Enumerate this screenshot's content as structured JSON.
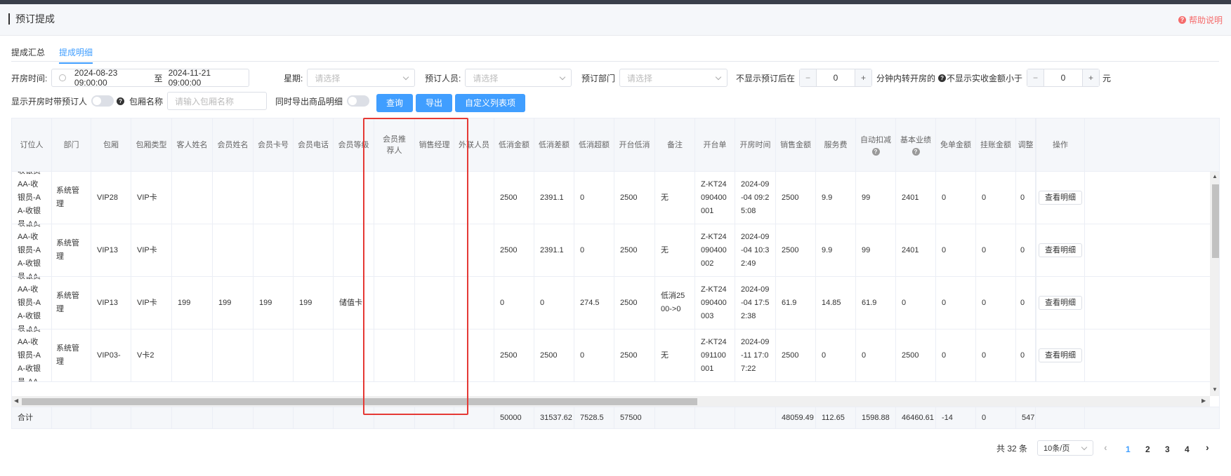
{
  "header": {
    "title": "预订提成",
    "help": "帮助说明"
  },
  "tabs": [
    {
      "label": "提成汇总",
      "active": false
    },
    {
      "label": "提成明细",
      "active": true
    }
  ],
  "filters": {
    "open_time_label": "开房时间:",
    "date_start": "2024-08-23 09:00:00",
    "date_sep": "至",
    "date_end": "2024-11-21 09:00:00",
    "weekday_label": "星期:",
    "weekday_placeholder": "请选择",
    "booker_label": "预订人员:",
    "booker_placeholder": "请选择",
    "dept_label": "预订部门",
    "dept_placeholder": "请选择",
    "hide_after_label": "不显示预订后在",
    "hide_after_value": "0",
    "minutes_label": "分钟内转开房的",
    "hide_amount_label": "不显示实收金额小于",
    "hide_amount_value": "0",
    "yuan": "元",
    "show_booker_label": "显示开房时带预订人",
    "room_name_label": "包厢名称",
    "room_name_placeholder": "请输入包厢名称",
    "export_goods_label": "同时导出商品明细",
    "query_btn": "查询",
    "export_btn": "导出",
    "custom_cols_btn": "自定义列表项",
    "minus": "−",
    "plus": "+"
  },
  "table": {
    "columns": [
      "订位人",
      "部门",
      "包厢",
      "包厢类型",
      "客人姓名",
      "会员姓名",
      "会员卡号",
      "会员电话",
      "会员等级",
      "会员推荐人",
      "销售经理",
      "外联人员",
      "低消金额",
      "低消差额",
      "低消超额",
      "开台低消",
      "备注",
      "开台单",
      "开房时间",
      "销售金额",
      "服务费",
      "自动扣减",
      "基本业绩",
      "免单金额",
      "挂账金额",
      "调整",
      "操作"
    ],
    "rows": [
      [
        "收银员-AA-收银员-AA-收银员-AA",
        "系统管理",
        "VIP28",
        "VIP卡",
        "",
        "",
        "",
        "",
        "",
        "",
        "",
        "",
        "2500",
        "2391.1",
        "0",
        "2500",
        "无",
        "Z-KT24090400001",
        "2024-09-04 09:25:08",
        "2500",
        "9.9",
        "99",
        "2401",
        "0",
        "0",
        "0",
        "查看明细"
      ],
      [
        "收银员-AA-收银员-AA-收银员-AA",
        "系统管理",
        "VIP13",
        "VIP卡",
        "",
        "",
        "",
        "",
        "",
        "",
        "",
        "",
        "2500",
        "2391.1",
        "0",
        "2500",
        "无",
        "Z-KT24090400002",
        "2024-09-04 10:32:49",
        "2500",
        "9.9",
        "99",
        "2401",
        "0",
        "0",
        "0",
        "查看明细"
      ],
      [
        "收银员-AA-收银员-AA-收银员-AA",
        "系统管理",
        "VIP13",
        "VIP卡",
        "199",
        "199",
        "199",
        "199",
        "储值卡",
        "",
        "",
        "",
        "0",
        "0",
        "274.5",
        "2500",
        "低消2500->0",
        "Z-KT24090400003",
        "2024-09-04 17:52:38",
        "61.9",
        "14.85",
        "61.9",
        "0",
        "0",
        "0",
        "0",
        "查看明细"
      ],
      [
        "收银员-AA-收银员-AA-收银员-AA",
        "系统管理",
        "VIP03-",
        "V卡2",
        "",
        "",
        "",
        "",
        "",
        "",
        "",
        "",
        "2500",
        "2500",
        "0",
        "2500",
        "无",
        "Z-KT24091100001",
        "2024-09-11 17:07:22",
        "2500",
        "0",
        "0",
        "2500",
        "0",
        "0",
        "0",
        "查看明细"
      ]
    ],
    "sum": [
      "合计",
      "",
      "",
      "",
      "",
      "",
      "",
      "",
      "",
      "",
      "",
      "",
      "50000",
      "31537.62",
      "7528.5",
      "57500",
      "",
      "",
      "",
      "48059.49",
      "112.65",
      "1598.88",
      "46460.61",
      "-14",
      "0",
      "547",
      ""
    ]
  },
  "pagination": {
    "total": "共 32 条",
    "page_size": "10条/页",
    "pages": [
      "1",
      "2",
      "3",
      "4"
    ],
    "current": "1",
    "prev": "‹",
    "next": "›"
  }
}
